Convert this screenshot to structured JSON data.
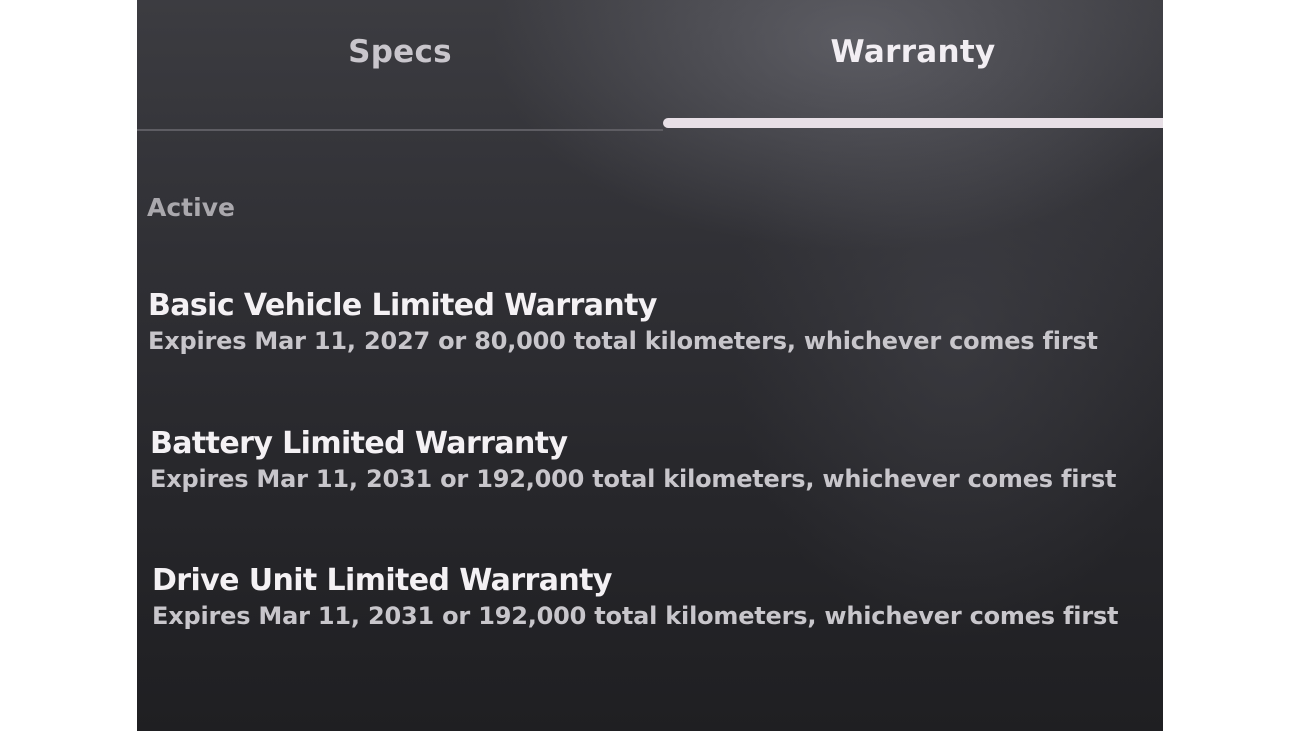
{
  "tabs": [
    {
      "label": "Specs",
      "active": false
    },
    {
      "label": "Warranty",
      "active": true
    }
  ],
  "section": {
    "label": "Active"
  },
  "warranties": [
    {
      "title": "Basic Vehicle Limited Warranty",
      "detail": "Expires Mar 11, 2027 or 80,000 total kilometers, whichever comes first"
    },
    {
      "title": "Battery Limited Warranty",
      "detail": "Expires Mar 11, 2031 or 192,000 total kilometers, whichever comes first"
    },
    {
      "title": "Drive Unit Limited Warranty",
      "detail": "Expires Mar 11, 2031 or 192,000 total kilometers, whichever comes first"
    }
  ],
  "colors": {
    "background": "#2a2a2e",
    "active_indicator": "#e7dfe6",
    "title_text": "#f4f1f4",
    "detail_text": "#c8c6cb"
  }
}
